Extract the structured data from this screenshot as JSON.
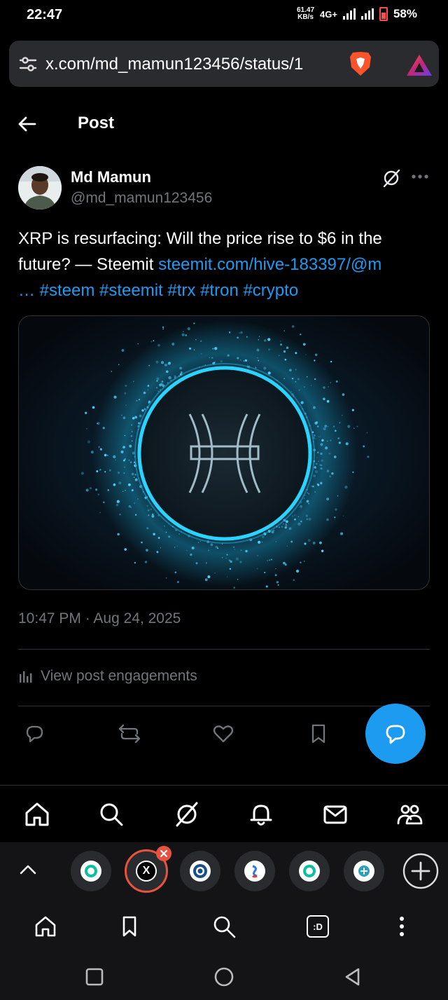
{
  "status_bar": {
    "time": "22:47",
    "net_speed_value": "61.47",
    "net_speed_unit": "KB/s",
    "network": "4G+",
    "battery": "58%"
  },
  "browser": {
    "url": "x.com/md_mamun123456/status/1"
  },
  "header": {
    "title": "Post"
  },
  "post": {
    "author_name": "Md Mamun",
    "author_handle": "@md_mamun123456",
    "text_plain": "XRP is resurfacing: Will the price rise to $6 in the future? — Steemit ",
    "text_link": "steemit.com/hive-183397/@m",
    "text_line3_link": "… #steem #steemit #trx #tron #crypto",
    "timestamp": "10:47 PM · Aug 24, 2025",
    "engagements_label": "View post engagements"
  },
  "colors": {
    "accent": "#1d9bf0",
    "muted": "#71767b",
    "background": "#000000",
    "close_badge": "#e8533f"
  },
  "icons": {
    "back": "arrow-left-icon",
    "grok": "grok-icon",
    "more": "more-horizontal-icon",
    "reply": "reply-icon",
    "repost": "repost-icon",
    "like": "heart-icon",
    "bookmark": "bookmark-icon",
    "compose": "compose-icon"
  }
}
